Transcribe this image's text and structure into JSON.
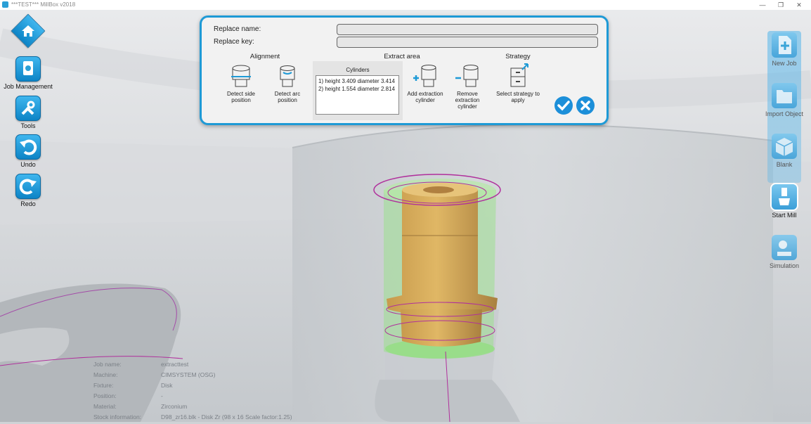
{
  "window": {
    "title": "***TEST*** MillBox v2018",
    "minimize": "—",
    "restore": "❐",
    "close": "✕"
  },
  "left_toolbar": [
    {
      "label": "",
      "icon": "home-icon"
    },
    {
      "label": "Job Management",
      "icon": "job-management-icon"
    },
    {
      "label": "Tools",
      "icon": "tools-icon"
    },
    {
      "label": "Undo",
      "icon": "undo-icon"
    },
    {
      "label": "Redo",
      "icon": "redo-icon"
    }
  ],
  "right_toolbar": [
    {
      "label": "New Job",
      "icon": "new-job-icon"
    },
    {
      "label": "Import Object",
      "icon": "import-object-icon"
    },
    {
      "label": "Blank",
      "icon": "blank-icon"
    },
    {
      "label": "Start Mill",
      "icon": "start-mill-icon",
      "active": true
    },
    {
      "label": "Simulation",
      "icon": "simulation-icon"
    }
  ],
  "dialog": {
    "replace_name_label": "Replace name:",
    "replace_name_value": "",
    "replace_key_label": "Replace key:",
    "replace_key_value": "",
    "alignment": {
      "title": "Alignment",
      "detect_side": "Detect side position",
      "detect_arc": "Detect arc position"
    },
    "extract_area": {
      "title": "Extract area",
      "cylinders_title": "Cylinders",
      "cylinders": [
        "1) height 3.409 diameter 3.414",
        "2) height 1.554 diameter 2.814"
      ],
      "add": "Add extraction cylinder",
      "remove": "Remove extraction cylinder"
    },
    "strategy": {
      "title": "Strategy",
      "select": "Select strategy to apply"
    },
    "ok_icon": "checkmark-icon",
    "cancel_icon": "close-icon",
    "accent": "#1e9ad6"
  },
  "job_info": [
    {
      "key": "Job name:",
      "value": "extracttest"
    },
    {
      "key": "Machine:",
      "value": "CIMSYSTEM (OSG)"
    },
    {
      "key": "Fixture:",
      "value": "Disk"
    },
    {
      "key": "Position:",
      "value": "-"
    },
    {
      "key": "Material:",
      "value": "Zirconium"
    },
    {
      "key": "Stock information:",
      "value": "D98_zr16.blk - Disk Zr (98 x 16 Scale factor:1.25)"
    }
  ]
}
